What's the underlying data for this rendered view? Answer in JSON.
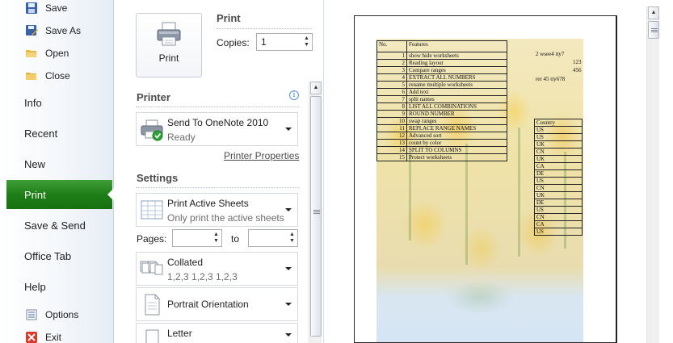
{
  "nav": {
    "commands": [
      {
        "label": "Save",
        "icon": "save-icon"
      },
      {
        "label": "Save As",
        "icon": "save-as-icon"
      },
      {
        "label": "Open",
        "icon": "open-folder-icon"
      },
      {
        "label": "Close",
        "icon": "close-folder-icon"
      }
    ],
    "tabs": [
      {
        "label": "Info"
      },
      {
        "label": "Recent"
      },
      {
        "label": "New"
      },
      {
        "label": "Print",
        "active": true
      },
      {
        "label": "Save & Send"
      },
      {
        "label": "Office Tab"
      },
      {
        "label": "Help"
      }
    ],
    "bottom": [
      {
        "label": "Options",
        "icon": "options-icon"
      },
      {
        "label": "Exit",
        "icon": "exit-icon"
      }
    ],
    "active_color": "#2a8a22"
  },
  "print_section": {
    "button_label": "Print",
    "heading": "Print",
    "copies_label": "Copies:",
    "copies_value": "1"
  },
  "printer": {
    "heading": "Printer",
    "name": "Send To OneNote 2010",
    "status": "Ready",
    "properties_link": "Printer Properties"
  },
  "settings": {
    "heading": "Settings",
    "scope": {
      "main": "Print Active Sheets",
      "sub": "Only print the active sheets"
    },
    "pages_label": "Pages:",
    "to_label": "to",
    "pages_from": "",
    "pages_to": "",
    "collation": {
      "main": "Collated",
      "sub": "1,2,3    1,2,3    1,2,3"
    },
    "orientation": {
      "main": "Portrait Orientation"
    },
    "paper": {
      "main": "Letter"
    }
  },
  "preview": {
    "table_header": {
      "no": "No.",
      "feature": "Features"
    },
    "features": [
      {
        "no": "1",
        "name": "show hide worksheets"
      },
      {
        "no": "2",
        "name": "Reading layout"
      },
      {
        "no": "3",
        "name": "Compare ranges"
      },
      {
        "no": "4",
        "name": "EXTRACT ALL NUMBERS"
      },
      {
        "no": "5",
        "name": "rename multiple worksheets"
      },
      {
        "no": "6",
        "name": "Add text"
      },
      {
        "no": "7",
        "name": "split names"
      },
      {
        "no": "8",
        "name": "LIST ALL COMBINATIONS"
      },
      {
        "no": "9",
        "name": "ROUND NUMBER"
      },
      {
        "no": "10",
        "name": "swap ranges"
      },
      {
        "no": "11",
        "name": "REPLACE RANGE NAMES"
      },
      {
        "no": "12",
        "name": "Advanced sort"
      },
      {
        "no": "13",
        "name": "count by color"
      },
      {
        "no": "14",
        "name": "SPLIT TO COLUMNS"
      },
      {
        "no": "15",
        "name": "Protect worksheets"
      }
    ],
    "side_text": [
      "2 wsee4 tty7",
      "123",
      "456",
      "rer 45 tty678"
    ],
    "country_header": "Country",
    "countries": [
      "US",
      "US",
      "UK",
      "CN",
      "UK",
      "CA",
      "DE",
      "US",
      "CN",
      "UK",
      "DE",
      "US",
      "CN",
      "CA",
      "US"
    ]
  }
}
